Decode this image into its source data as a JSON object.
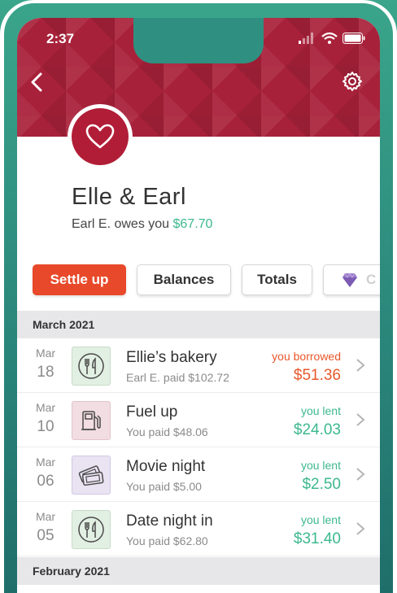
{
  "status_bar": {
    "time": "2:37"
  },
  "group": {
    "name": "Elle & Earl",
    "balance_prefix": "Earl E. owes you ",
    "balance_amount": "$67.70"
  },
  "actions": {
    "settle_up": "Settle up",
    "balances": "Balances",
    "totals": "Totals",
    "partial": "C"
  },
  "sections": [
    {
      "label": "March 2021",
      "expenses": [
        {
          "month": "Mar",
          "day": "18",
          "title": "Ellie’s bakery",
          "subtitle": "Earl E. paid $102.72",
          "status": "you borrowed",
          "amount": "$51.36",
          "category_icon": "fork-knife-icon",
          "tone": "orange"
        },
        {
          "month": "Mar",
          "day": "10",
          "title": "Fuel up",
          "subtitle": "You paid $48.06",
          "status": "you lent",
          "amount": "$24.03",
          "category_icon": "fuel-pump-icon",
          "tone": "green"
        },
        {
          "month": "Mar",
          "day": "06",
          "title": "Movie night",
          "subtitle": "You paid $5.00",
          "status": "you lent",
          "amount": "$2.50",
          "category_icon": "ticket-icon",
          "tone": "green"
        },
        {
          "month": "Mar",
          "day": "05",
          "title": "Date night in",
          "subtitle": "You paid $62.80",
          "status": "you lent",
          "amount": "$31.40",
          "category_icon": "fork-knife-icon",
          "tone": "green"
        }
      ]
    },
    {
      "label": "February 2021",
      "expenses": []
    }
  ],
  "colors": {
    "header": "#a8213a",
    "accent_orange": "#e8492a",
    "positive_green": "#3cb88f",
    "food_bg": "#e2efe3",
    "fuel_bg": "#f2dde3",
    "ticket_bg": "#e9e3f2"
  }
}
